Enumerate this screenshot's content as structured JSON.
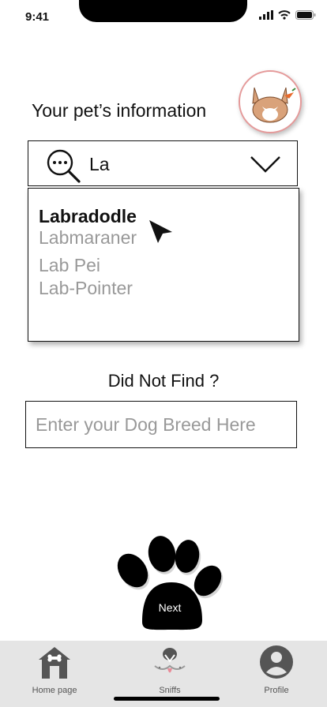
{
  "status_bar": {
    "time": "9:41"
  },
  "header": {
    "title": "Your pet’s information"
  },
  "search": {
    "value": "La"
  },
  "dropdown": {
    "options": [
      "Labradodle",
      "Labmaraner",
      "Lab Pei",
      "Lab-Pointer"
    ],
    "selected_index": 0
  },
  "fallback": {
    "prompt": "Did Not Find ?",
    "placeholder": "Enter your Dog Breed Here"
  },
  "next_button": {
    "label": "Next"
  },
  "tab_bar": {
    "items": [
      {
        "label": "Home page",
        "icon": "home-icon"
      },
      {
        "label": "Sniffs",
        "icon": "dog-face-icon"
      },
      {
        "label": "Profile",
        "icon": "profile-icon"
      }
    ]
  },
  "colors": {
    "avatar_border": "#e59a9a",
    "tab_bar_bg": "#e5e5e5",
    "muted_text": "#999999"
  }
}
